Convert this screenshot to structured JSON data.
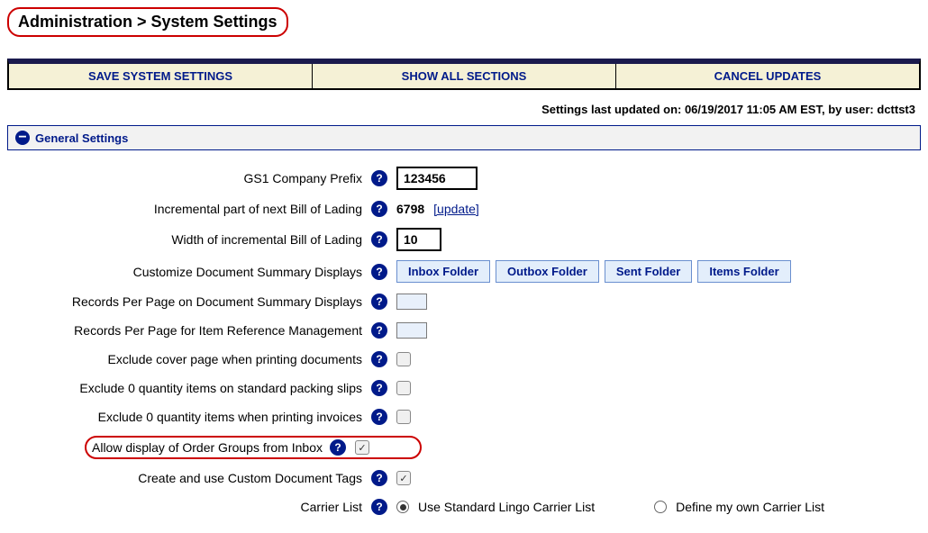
{
  "breadcrumb": "Administration > System Settings",
  "toolbar": {
    "save": "SAVE SYSTEM SETTINGS",
    "show": "SHOW ALL SECTIONS",
    "cancel": "CANCEL UPDATES"
  },
  "status": "Settings last updated on: 06/19/2017 11:05 AM EST, by user: dcttst3",
  "section": {
    "title": "General Settings"
  },
  "fields": {
    "gs1_label": "GS1 Company Prefix",
    "gs1_value": "123456",
    "bol_inc_label": "Incremental part of next Bill of Lading",
    "bol_inc_value": "6798",
    "bol_inc_update": "[update]",
    "bol_width_label": "Width of incremental Bill of Lading",
    "bol_width_value": "10",
    "doc_summary_label": "Customize Document Summary Displays",
    "folders": {
      "inbox": "Inbox Folder",
      "outbox": "Outbox Folder",
      "sent": "Sent Folder",
      "items": "Items Folder"
    },
    "records_doc_label": "Records Per Page on Document Summary Displays",
    "records_item_label": "Records Per Page for Item Reference Management",
    "exclude_cover_label": "Exclude cover page when printing documents",
    "exclude_qty_slips_label": "Exclude 0 quantity items on standard packing slips",
    "exclude_qty_inv_label": "Exclude 0 quantity items when printing invoices",
    "allow_order_groups_label": "Allow display of Order Groups from Inbox",
    "custom_tags_label": "Create and use Custom Document Tags",
    "carrier_label": "Carrier List",
    "carrier_std": "Use Standard Lingo Carrier List",
    "carrier_own": "Define my own Carrier List"
  }
}
